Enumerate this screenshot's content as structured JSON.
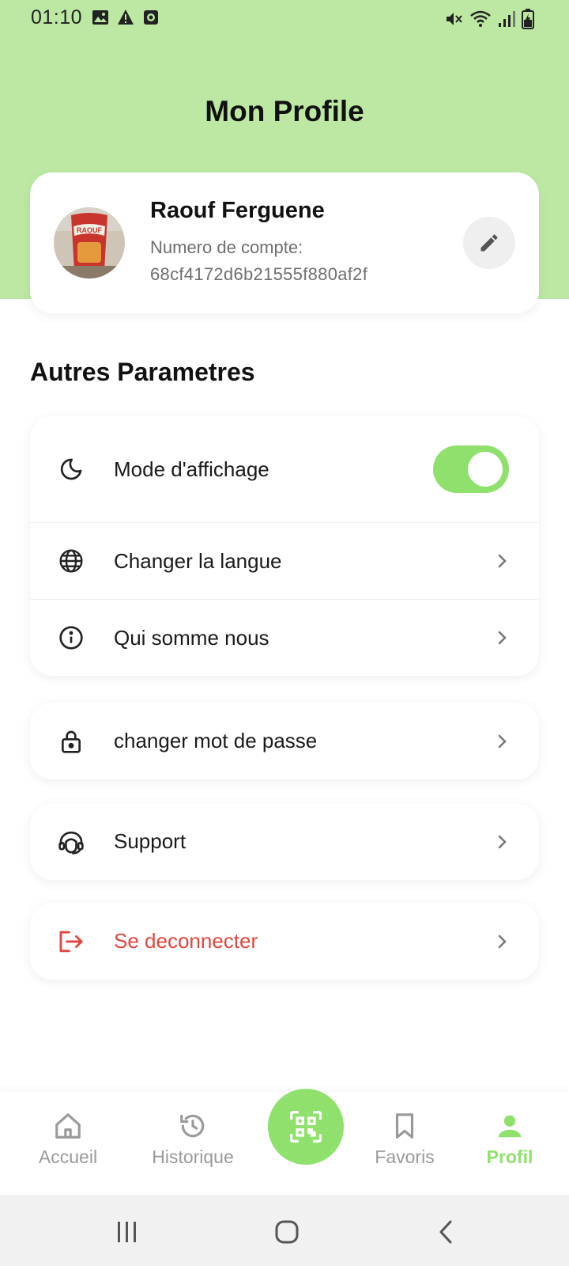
{
  "status_bar": {
    "time": "01:10",
    "left_icons": [
      "image-icon",
      "warning-icon",
      "recorder-icon"
    ],
    "right_icons": [
      "mute-icon",
      "wifi-icon",
      "signal-icon",
      "battery-charging-icon"
    ]
  },
  "header": {
    "title": "Mon Profile"
  },
  "profile": {
    "name": "Raouf Ferguene",
    "account_label": "Numero de compte:",
    "account_number": "68cf4172d6b21555f880af2f",
    "avatar_text": "RAOUF",
    "edit_icon": "pencil-icon"
  },
  "section_title": "Autres Parametres",
  "settings": {
    "display_mode": {
      "label": "Mode d'affichage",
      "icon": "moon-icon",
      "enabled": true
    },
    "language": {
      "label": "Changer la langue",
      "icon": "globe-icon"
    },
    "about": {
      "label": "Qui somme nous",
      "icon": "info-icon"
    },
    "password": {
      "label": "changer mot de passe",
      "icon": "lock-icon"
    },
    "support": {
      "label": "Support",
      "icon": "headset-icon"
    },
    "logout": {
      "label": "Se deconnecter",
      "icon": "logout-icon"
    }
  },
  "bottom_nav": {
    "home": "Accueil",
    "history": "Historique",
    "scan_icon": "qr-scan-icon",
    "favorites": "Favoris",
    "profile": "Profil",
    "active": "profile"
  },
  "colors": {
    "header_bg": "#bce8a3",
    "accent": "#90e06d",
    "danger": "#e0473e"
  }
}
